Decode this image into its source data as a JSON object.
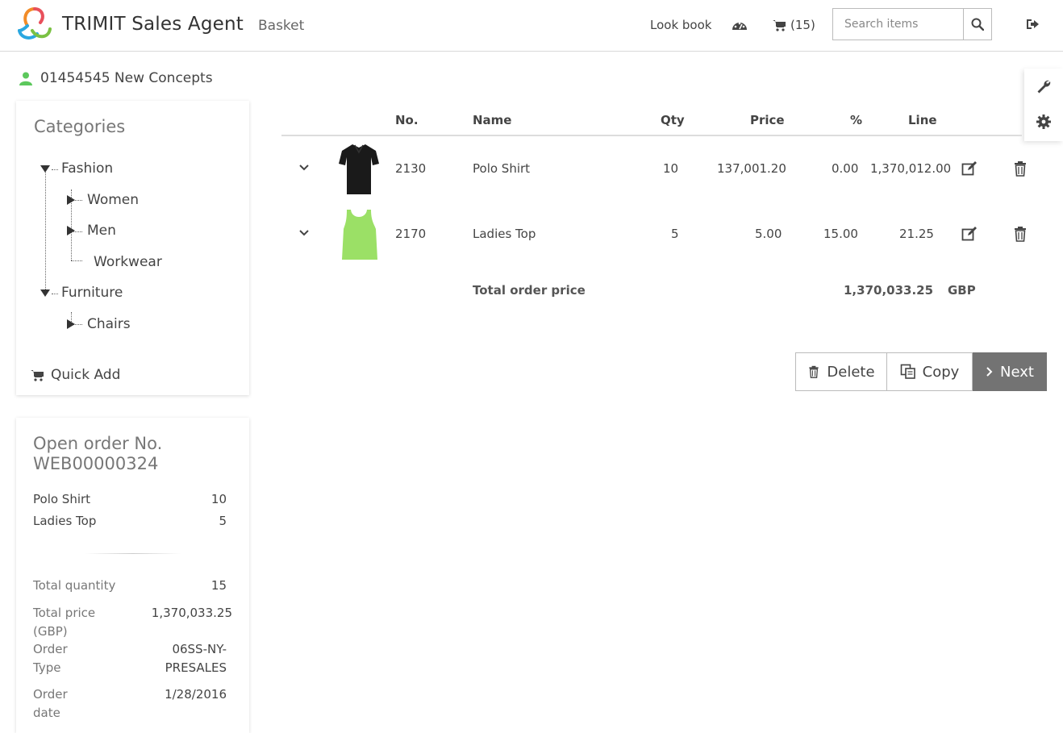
{
  "header": {
    "app_title": "TRIMIT Sales Agent",
    "section": "Basket",
    "lookbook_label": "Look book",
    "cart_count_label": "(15)",
    "search_placeholder": "Search items"
  },
  "customer": {
    "label": "01454545 New Concepts"
  },
  "categories": {
    "title": "Categories",
    "tree": [
      {
        "label": "Fashion",
        "children": [
          "Women",
          "Men",
          "Workwear"
        ]
      },
      {
        "label": "Furniture",
        "children": [
          "Chairs"
        ]
      }
    ],
    "quick_add_label": "Quick Add"
  },
  "basket": {
    "columns": [
      "No.",
      "Name",
      "Qty",
      "Price",
      "%",
      "Line"
    ],
    "rows": [
      {
        "no": "2130",
        "name": "Polo Shirt",
        "qty": "10",
        "price": "137,001.20",
        "pct": "0.00",
        "line": "1,370,012.00",
        "image": "black-polo-shirt"
      },
      {
        "no": "2170",
        "name": "Ladies Top",
        "qty": "5",
        "price": "5.00",
        "pct": "15.00",
        "line": "21.25",
        "image": "green-tank-top"
      }
    ],
    "total_label": "Total order price",
    "total_value": "1,370,033.25",
    "total_currency": "GBP"
  },
  "actions": {
    "delete_label": "Delete",
    "copy_label": "Copy",
    "next_label": "Next"
  },
  "open_order": {
    "title_line1": "Open order No.",
    "title_line2": "WEB00000324",
    "items": [
      {
        "name": "Polo Shirt",
        "qty": "10"
      },
      {
        "name": "Ladies Top",
        "qty": "5"
      }
    ],
    "summary": {
      "total_qty_label": "Total quantity",
      "total_qty": "15",
      "total_price_label_1": "Total price",
      "total_price_label_2": "(GBP)",
      "total_price": "1,370,033.25",
      "order_type_label_1": "Order",
      "order_type_label_2": "Type",
      "order_type_1": "06SS-NY-",
      "order_type_2": "PRESALES",
      "order_date_label_1": "Order",
      "order_date_label_2": "date",
      "order_date": "1/28/2016"
    }
  },
  "colors": {
    "accent_next": "#737373",
    "customer_icon": "#5cc85c",
    "top_green": "#9be066"
  },
  "icons": [
    "logo-icon",
    "dashboard-icon",
    "cart-icon",
    "search-icon",
    "logout-icon",
    "wrench-icon",
    "gear-icon",
    "user-icon",
    "edit-icon",
    "trash-icon",
    "copy-icon",
    "chevron-right-icon",
    "chevron-down-icon"
  ]
}
